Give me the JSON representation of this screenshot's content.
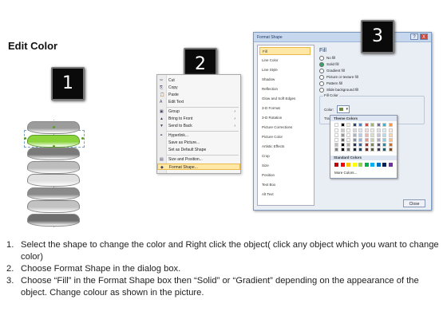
{
  "title": "Edit Color",
  "badges": [
    "1",
    "2",
    "3"
  ],
  "context_menu": {
    "items": [
      {
        "icon": "✂",
        "label": "Cut"
      },
      {
        "icon": "⎘",
        "label": "Copy"
      },
      {
        "icon": "📋",
        "label": "Paste"
      },
      {
        "icon": "A",
        "label": "Edit Text"
      },
      {
        "icon": "▣",
        "label": "Group",
        "arrow": "›"
      },
      {
        "icon": "▲",
        "label": "Bring to Front",
        "arrow": "›"
      },
      {
        "icon": "▼",
        "label": "Send to Back",
        "arrow": "›"
      },
      {
        "icon": "⚭",
        "label": "Hyperlink..."
      },
      {
        "icon": "",
        "label": "Save as Picture..."
      },
      {
        "icon": "",
        "label": "Set as Default Shape"
      },
      {
        "icon": "▤",
        "label": "Size and Position..."
      },
      {
        "icon": "◆",
        "label": "Format Shape..."
      }
    ]
  },
  "dialog": {
    "title": "Format Shape",
    "help": "?",
    "close": "X",
    "categories": [
      "Fill",
      "Line Color",
      "Line Style",
      "Shadow",
      "Reflection",
      "Glow and Soft Edges",
      "3-D Format",
      "3-D Rotation",
      "Picture Corrections",
      "Picture Color",
      "Artistic Effects",
      "Crop",
      "Size",
      "Position",
      "Text Box",
      "Alt Text"
    ],
    "selected_category": "Fill",
    "pane_heading": "Fill",
    "fill_options": [
      "No fill",
      "Solid fill",
      "Gradient fill",
      "Picture or texture fill",
      "Pattern fill",
      "Slide background fill"
    ],
    "selected_fill": "Solid fill",
    "group_label": "Fill Color",
    "color_label": "Color:",
    "transparency_label": "Transpa",
    "close_button": "Close"
  },
  "palette": {
    "theme_label": "Theme Colors",
    "standard_label": "Standard Colors",
    "more_label": "More Colors...",
    "theme_colors": [
      "#ffffff",
      "#000000",
      "#eeece1",
      "#1f497d",
      "#4f81bd",
      "#c0504d",
      "#9bbb59",
      "#8064a2",
      "#4bacc6",
      "#f79646"
    ],
    "standard_colors": [
      "#c00000",
      "#ff0000",
      "#ffc000",
      "#ffff00",
      "#92d050",
      "#00b050",
      "#00b0f0",
      "#0070c0",
      "#002060",
      "#7030a0"
    ]
  },
  "shape_stack": {
    "colors": [
      "#9c9c9c",
      "#8cd43c",
      "#7a7a7a",
      "#bdbdbd",
      "#e0e0e0",
      "#8a8a8a",
      "#c2c2c2",
      "#6e6e6e"
    ]
  },
  "steps": [
    {
      "n": "1.",
      "text": "Select the shape to change the color and Right click the object( click any object which you want to change color)"
    },
    {
      "n": "2.",
      "text": "Choose Format Shape in the dialog box."
    },
    {
      "n": "3.",
      "text": "Choose “Fill” in the Format Shape box then “Solid” or “Gradient” depending on the appearance of the object. Change colour as shown in the picture."
    }
  ]
}
